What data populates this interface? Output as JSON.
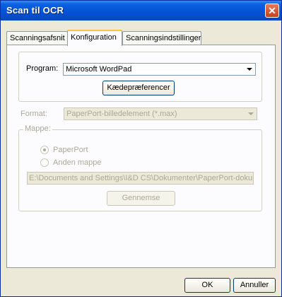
{
  "window": {
    "title": "Scan til OCR",
    "close_glyph": "✕"
  },
  "tabs": [
    "Scanningsafsnit",
    "Konfiguration",
    "Scanningsindstillinger"
  ],
  "program": {
    "label": "Program:",
    "value": "Microsoft WordPad",
    "button": "Kædepræferencer"
  },
  "format": {
    "label": "Format:",
    "value": "PaperPort-billedelement (*.max)"
  },
  "folder": {
    "legend": "Mappe:",
    "option1": "PaperPort",
    "option2": "Anden mappe",
    "path": "E:\\Documents and Settings\\I&D CS\\Dokumenter\\PaperPort-dokument",
    "browse": "Gennemse"
  },
  "buttons": {
    "ok": "OK",
    "cancel": "Annuller"
  },
  "icons": {
    "close": "close-icon",
    "dropdown": "chevron-down-icon"
  }
}
